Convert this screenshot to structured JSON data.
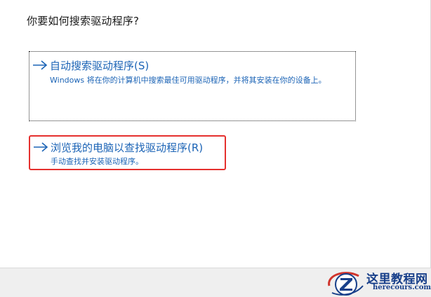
{
  "dialog": {
    "question": "你要如何搜索驱动程序?"
  },
  "options": [
    {
      "icon": "arrow-right-icon",
      "title": "自动搜索驱动程序(S)",
      "description": "Windows 将在你的计算机中搜索最佳可用驱动程序，并将其安装在你的设备上。"
    },
    {
      "icon": "arrow-right-icon",
      "title": "浏览我的电脑以查找驱动程序(R)",
      "description": "手动查找并安装驱动程序。"
    }
  ],
  "watermark": {
    "name": "这里教程网",
    "url": "herecours.com"
  },
  "colors": {
    "link": "#1c64b6",
    "highlight": "#e5302e",
    "watermark": "#173f8a"
  }
}
